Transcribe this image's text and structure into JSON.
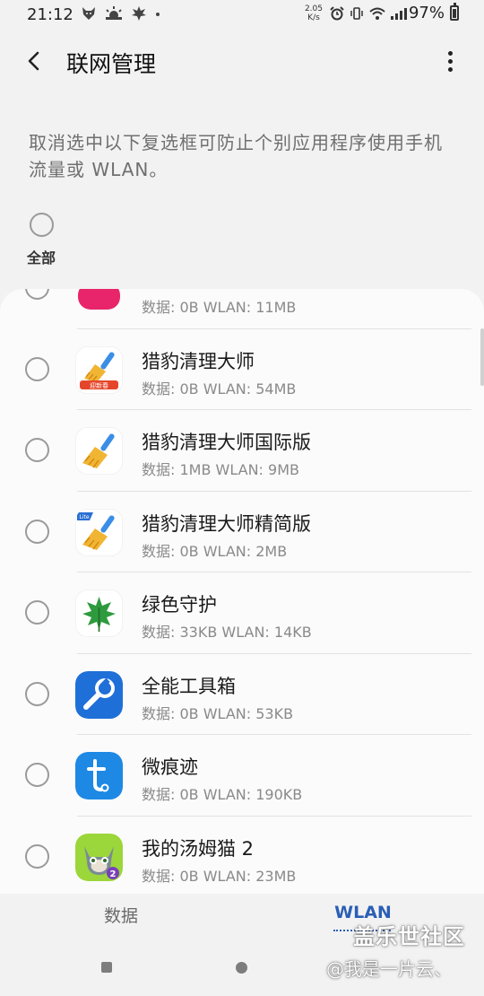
{
  "status_bar": {
    "time": "21:12",
    "left_icons": [
      "fox-icon",
      "weather-icon",
      "leaf-icon",
      "dot-icon"
    ],
    "net_speed_value": "2.05",
    "net_speed_unit": "K/s",
    "right_icons": [
      "alarm-icon",
      "vibrate-icon",
      "wifi-icon",
      "signal-4g-icon"
    ],
    "battery_text": "97%"
  },
  "app_bar": {
    "title": "联网管理"
  },
  "description": "取消选中以下复选框可防止个别应用程序使用手机流量或 WLAN。",
  "select_all": {
    "label": "全部",
    "checked": false
  },
  "apps": [
    {
      "name": "",
      "usage": "数据: 0B  WLAN: 11MB",
      "icon": "partial-pink-icon",
      "checked": false
    },
    {
      "name": "猎豹清理大师",
      "usage": "数据: 0B  WLAN: 54MB",
      "icon": "broom-icon",
      "badge": "迎新春",
      "checked": false
    },
    {
      "name": "猎豹清理大师国际版",
      "usage": "数据: 1MB  WLAN: 9MB",
      "icon": "broom-icon",
      "checked": false
    },
    {
      "name": "猎豹清理大师精简版",
      "usage": "数据: 0B  WLAN: 2MB",
      "icon": "broom-lite-icon",
      "badge": "Lite",
      "checked": false
    },
    {
      "name": "绿色守护",
      "usage": "数据: 33KB  WLAN: 14KB",
      "icon": "green-leaf-icon",
      "checked": false
    },
    {
      "name": "全能工具箱",
      "usage": "数据: 0B  WLAN: 53KB",
      "icon": "wrench-icon",
      "checked": false
    },
    {
      "name": "微痕迹",
      "usage": "数据: 0B  WLAN: 190KB",
      "icon": "trace-t-icon",
      "checked": false
    },
    {
      "name": "我的汤姆猫 2",
      "usage": "数据: 0B  WLAN: 23MB",
      "icon": "tom-cat-icon",
      "checked": false
    }
  ],
  "tabs": [
    {
      "label": "数据",
      "active": false
    },
    {
      "label": "WLAN",
      "active": true
    }
  ],
  "watermark": {
    "line1": "盖乐世社区",
    "line2": "@我是一片云、"
  },
  "colors": {
    "accent": "#2a5fb5",
    "background": "#f2f2f2",
    "card": "#fbfbfb"
  }
}
